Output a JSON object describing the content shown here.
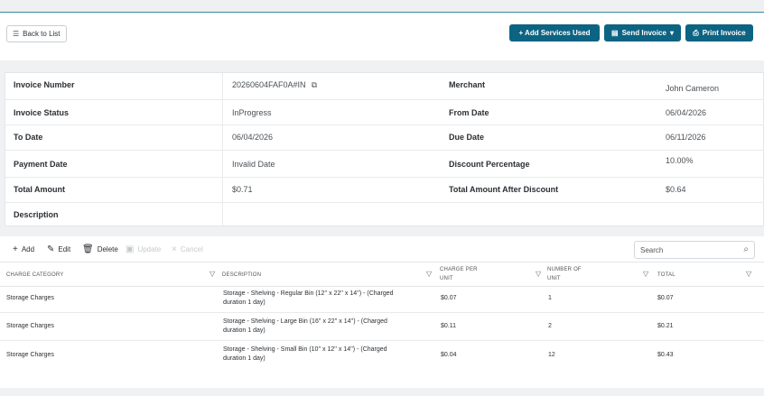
{
  "actions": {
    "back_label": "Back to List",
    "add_services_label": "+ Add Services Used",
    "send_invoice_label": "Send Invoice",
    "print_invoice_label": "Print Invoice"
  },
  "invoice": {
    "invoice_number_label": "Invoice Number",
    "invoice_number_value": "20260604FAF0A#IN",
    "merchant_label": "Merchant",
    "merchant_value": "John Cameron",
    "invoice_status_label": "Invoice Status",
    "invoice_status_value": "InProgress",
    "from_date_label": "From Date",
    "from_date_value": "06/04/2026",
    "to_date_label": "To Date",
    "to_date_value": "06/04/2026",
    "due_date_label": "Due Date",
    "due_date_value": "06/11/2026",
    "payment_date_label": "Payment Date",
    "payment_date_value": "Invalid Date",
    "discount_label": "Discount Percentage",
    "discount_value": "10.00%",
    "total_amount_label": "Total Amount",
    "total_amount_value": "$0.71",
    "total_after_discount_label": "Total Amount After Discount",
    "total_after_discount_value": "$0.64",
    "description_label": "Description"
  },
  "grid_toolbar": {
    "add": "Add",
    "edit": "Edit",
    "delete": "Delete",
    "update": "Update",
    "cancel": "Cancel",
    "search_placeholder": "Search"
  },
  "columns": {
    "charge_category": "CHARGE CATEGORY",
    "description": "DESCRIPTION",
    "charge_per_unit_1": "CHARGE PER",
    "charge_per_unit_2": "UNIT",
    "number_of_unit_1": "NUMBER OF",
    "number_of_unit_2": "UNIT",
    "total": "TOTAL"
  },
  "rows": [
    {
      "category": "Storage Charges",
      "desc1": "Storage - Shelving - Regular Bin (12'' x 22'' x 14'') - (Charged",
      "desc2": "duration 1 day)",
      "charge_per_unit": "$0.07",
      "units": "1",
      "total": "$0.07"
    },
    {
      "category": "Storage Charges",
      "desc1": "Storage - Shelving - Large Bin (16'' x 22'' x 14'') - (Charged",
      "desc2": "duration 1 day)",
      "charge_per_unit": "$0.11",
      "units": "2",
      "total": "$0.21"
    },
    {
      "category": "Storage Charges",
      "desc1": "Storage - Shelving - Small Bin (10'' x 12'' x 14'') - (Charged",
      "desc2": "duration 1 day)",
      "charge_per_unit": "$0.04",
      "units": "12",
      "total": "$0.43"
    }
  ],
  "icons": {
    "list": "list-icon",
    "file": "file-icon",
    "caret": "caret-down-icon",
    "print": "print-icon",
    "copy": "copy-icon",
    "plus": "plus-icon",
    "pencil": "pencil-icon",
    "trash": "trash-icon",
    "save": "save-icon",
    "close": "close-icon",
    "search": "search-icon",
    "filter": "filter-icon"
  },
  "colors": {
    "primary": "#0d6382",
    "accent_line": "#3f8fa8"
  }
}
